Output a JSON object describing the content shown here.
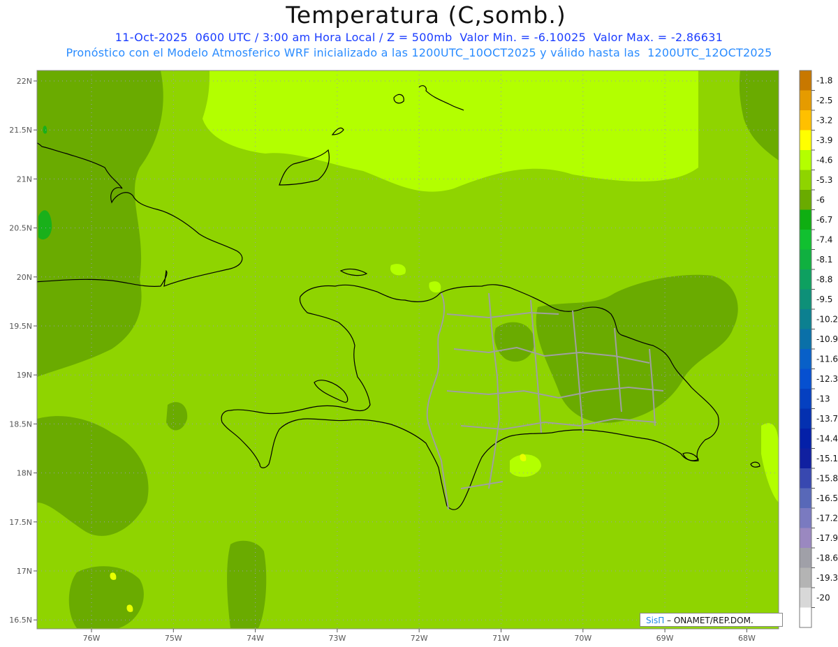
{
  "header": {
    "title": "Temperatura (C,somb.)",
    "subtitle_line1": "11-Oct-2025  0600 UTC / 3:00 am Hora Local / Z = 500mb  Valor Min. = -6.10025  Valor Max. = -2.86631",
    "subtitle_line2": "Pronóstico con el Modelo Atmosferico WRF inicializado a las 1200UTC_10OCT2025 y válido hasta las  1200UTC_12OCT2025"
  },
  "credit": {
    "brand": "SisΠ",
    "text": " – ONAMET/REP.DOM."
  },
  "map": {
    "latitude_labels": [
      "22N",
      "21.5N",
      "21N",
      "20.5N",
      "20N",
      "19.5N",
      "19N",
      "18.5N",
      "18N",
      "17.5N",
      "17N",
      "16.5N"
    ],
    "longitude_labels": [
      "76W",
      "75W",
      "74W",
      "73W",
      "72W",
      "71W",
      "70W",
      "69W",
      "68W"
    ],
    "fill_colors": {
      "base": "#8fd400",
      "darker": "#6aab00",
      "lighter": "#b3ff00",
      "darkest": "#19b01a",
      "yellow": "#e8ff00"
    },
    "border_colors": {
      "coast": "#000000",
      "provinces": "#a0a0a0"
    }
  },
  "colorbar": {
    "labels": [
      "-1.8",
      "-2.5",
      "-3.2",
      "-3.9",
      "-4.6",
      "-5.3",
      "-6",
      "-6.7",
      "-7.4",
      "-8.1",
      "-8.8",
      "-9.5",
      "-10.2",
      "-10.9",
      "-11.6",
      "-12.3",
      "-13",
      "-13.7",
      "-14.4",
      "-15.1",
      "-15.8",
      "-16.5",
      "-17.2",
      "-17.9",
      "-18.6",
      "-19.3",
      "-20"
    ],
    "colors": [
      "#c87800",
      "#e59b00",
      "#ffc000",
      "#ffff00",
      "#b4ff00",
      "#8fd400",
      "#6aab00",
      "#0fae12",
      "#11c030",
      "#10b040",
      "#0ea060",
      "#0e9078",
      "#0c8090",
      "#0a70a8",
      "#0860c8",
      "#0650d0",
      "#0540c0",
      "#0430b0",
      "#0420a8",
      "#1020a0",
      "#3848b0",
      "#5868b8",
      "#7a7ac0",
      "#9a88c0",
      "#a0a0a8",
      "#b4b4b4",
      "#d8d8d8",
      "#ffffff"
    ]
  }
}
